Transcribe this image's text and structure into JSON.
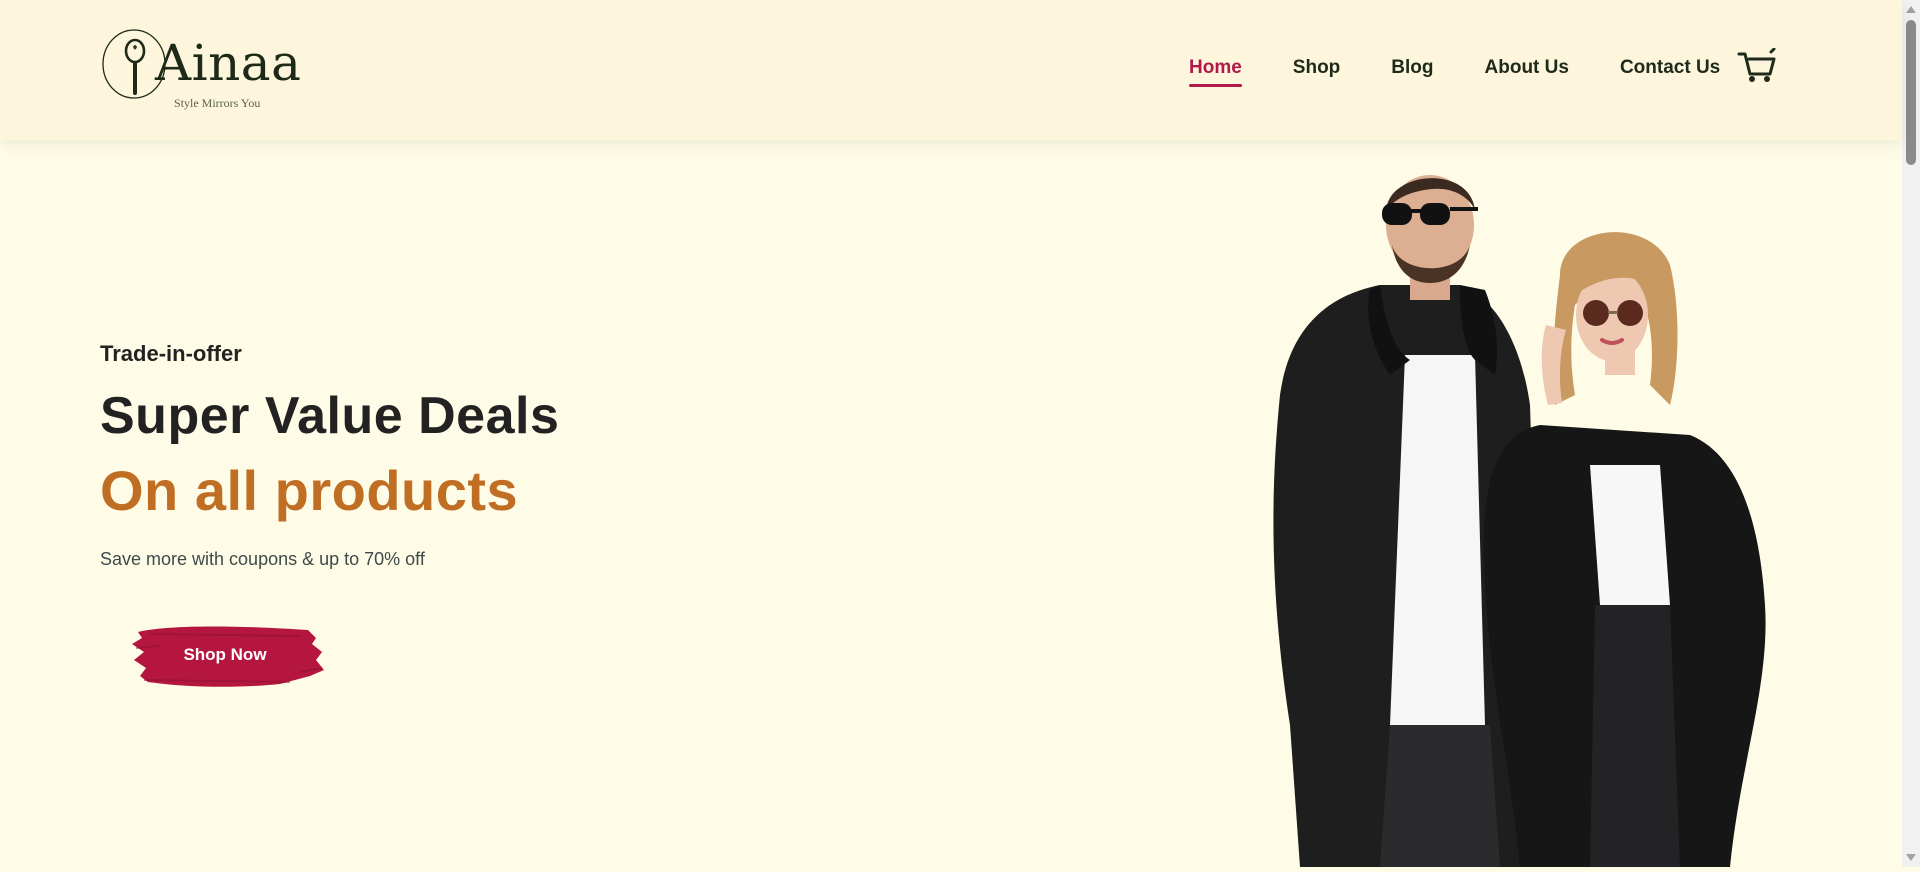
{
  "brand": {
    "name": "Ainaa",
    "tagline": "Style Mirrors You",
    "logo_color": "#1d2a17"
  },
  "nav": {
    "items": [
      {
        "label": "Home",
        "active": true
      },
      {
        "label": "Shop",
        "active": false
      },
      {
        "label": "Blog",
        "active": false
      },
      {
        "label": "About Us",
        "active": false
      },
      {
        "label": "Contact Us",
        "active": false
      }
    ],
    "cart_icon": "cart-icon",
    "active_color": "#b0194a"
  },
  "hero": {
    "kicker": "Trade-in-offer",
    "headline": "Super Value Deals",
    "headline_accent": "On all products",
    "subtext": "Save more with coupons & up to 70% off",
    "cta_label": "Shop Now",
    "accent_color": "#bf6e24",
    "cta_color": "#b5163f",
    "image": "couple-in-black-leather-jackets"
  },
  "colors": {
    "background": "#fefbe6",
    "header_background": "#fdf6dc"
  }
}
